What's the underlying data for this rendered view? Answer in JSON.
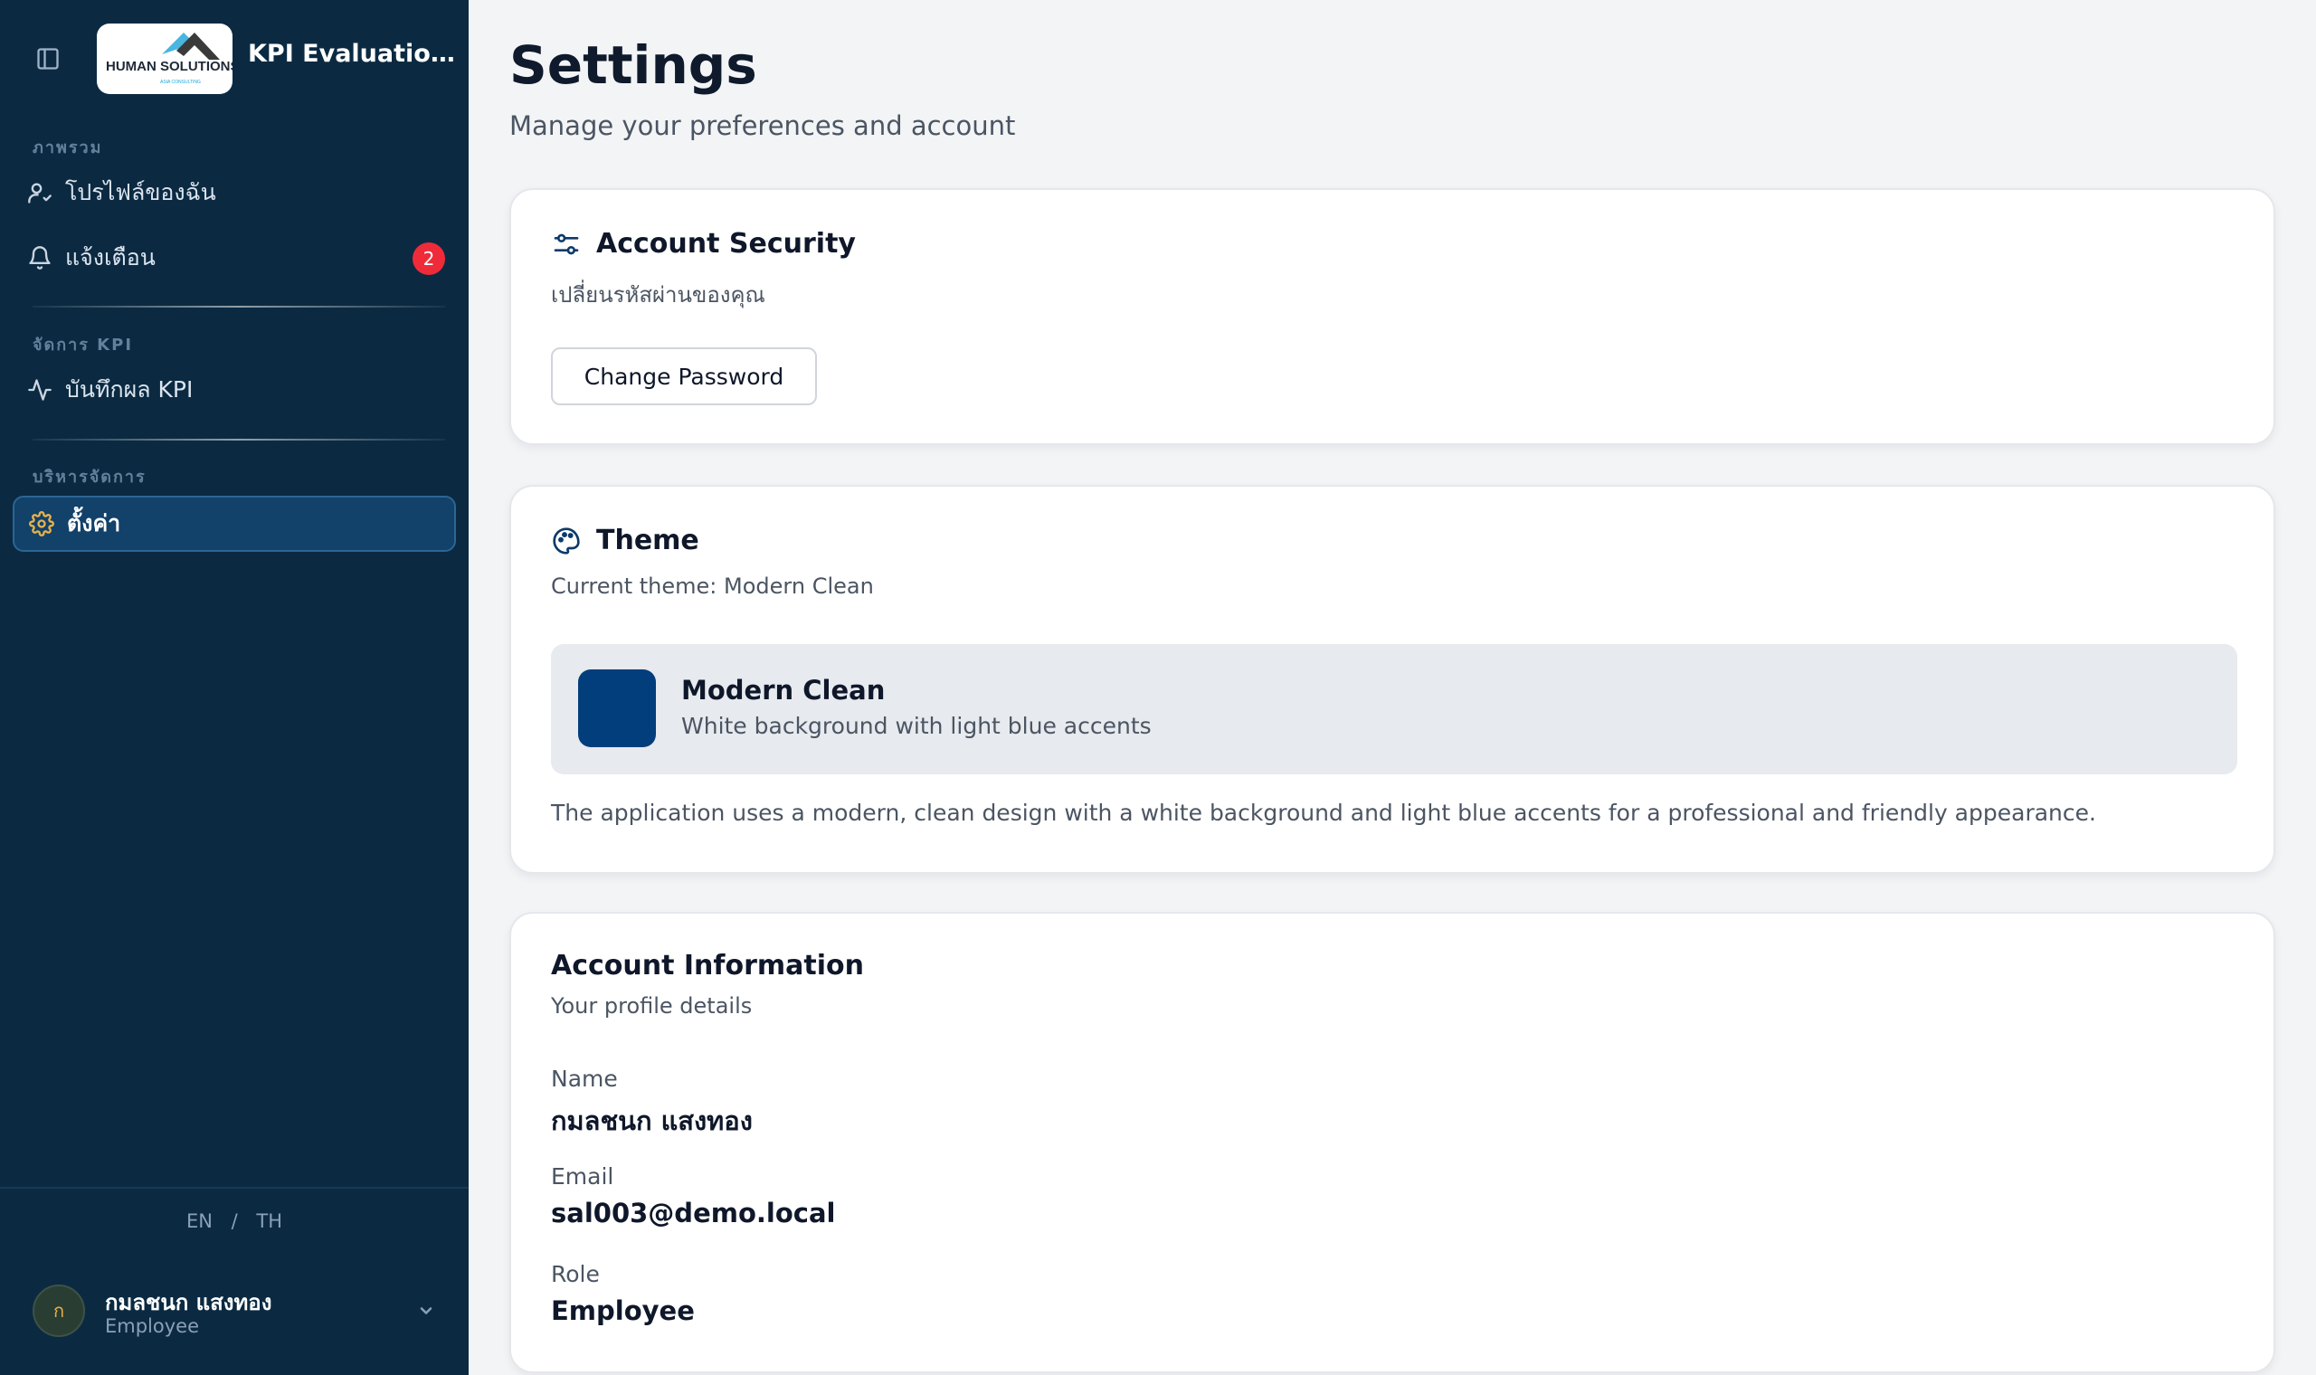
{
  "app": {
    "name": "KPI Evaluation ...",
    "logo_text": "HUMAN SOLUTIONS",
    "logo_subtext": "ASIA CONSULTING"
  },
  "sidebar": {
    "sections": [
      {
        "label": "ภาพรวม",
        "items": [
          {
            "label": "โปรไฟล์ของฉัน",
            "icon": "user-icon"
          },
          {
            "label": "แจ้งเตือน",
            "icon": "bell-icon",
            "badge": "2"
          }
        ]
      },
      {
        "label": "จัดการ KPI",
        "items": [
          {
            "label": "บันทึกผล KPI",
            "icon": "activity-icon"
          }
        ]
      },
      {
        "label": "บริหารจัดการ",
        "items": [
          {
            "label": "ตั้งค่า",
            "icon": "gear-icon",
            "active": true
          }
        ]
      }
    ],
    "language": {
      "en": "EN",
      "separator": "/",
      "th": "TH"
    },
    "user": {
      "initial": "ก",
      "name": "กมลชนก แสงทอง",
      "role": "Employee"
    }
  },
  "page": {
    "title": "Settings",
    "subtitle": "Manage your preferences and account"
  },
  "security": {
    "title": "Account Security",
    "description": "เปลี่ยนรหัสผ่านของคุณ",
    "button": "Change Password"
  },
  "theme": {
    "title": "Theme",
    "current": "Current theme: Modern Clean",
    "option_name": "Modern Clean",
    "option_desc": "White background with light blue accents",
    "swatch_color": "#033e7c",
    "note": "The application uses a modern, clean design with a white background and light blue accents for a professional and friendly appearance."
  },
  "account": {
    "title": "Account Information",
    "description": "Your profile details",
    "fields": [
      {
        "label": "Name",
        "value": "กมลชนก แสงทอง"
      },
      {
        "label": "Email",
        "value": "sal003@demo.local"
      },
      {
        "label": "Role",
        "value": "Employee"
      }
    ]
  },
  "colors": {
    "sidebar_bg": "#0b2a42",
    "active_item_bg": "#12416a",
    "badge": "#ef2b3a",
    "page_bg": "#f3f4f6"
  }
}
